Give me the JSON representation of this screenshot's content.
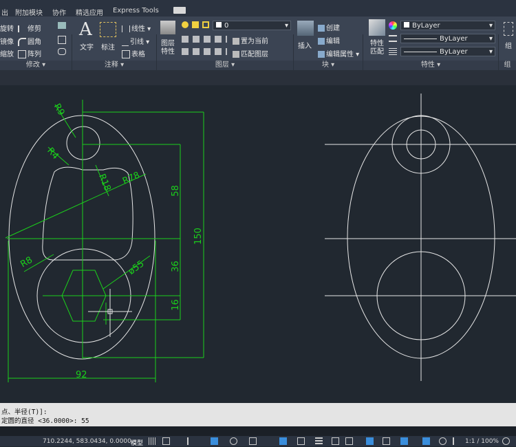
{
  "menu": {
    "items": [
      "出",
      "附加模块",
      "协作",
      "精选应用",
      "Express Tools"
    ]
  },
  "ribbon": {
    "modify": {
      "items": [
        "旋转",
        "修剪",
        "镜像",
        "圆角",
        "缩放",
        "阵列"
      ],
      "title": "修改"
    },
    "annotate": {
      "text_label": "文字",
      "dim_label": "标注",
      "linear": "线性",
      "leader": "引线",
      "table": "表格",
      "title": "注释"
    },
    "layers": {
      "props_label": "图层\n特性",
      "layer_value": "0",
      "set_current": "置为当前",
      "match_layer": "匹配图层",
      "title": "图层"
    },
    "block": {
      "insert_label": "插入",
      "create": "创建",
      "edit": "编辑",
      "edit_attr": "编辑属性",
      "title": "块"
    },
    "properties": {
      "match_label": "特性\n匹配",
      "color": "ByLayer",
      "linetype": "ByLayer",
      "lineweight": "ByLayer",
      "title": "特性"
    },
    "group": {
      "label": "组"
    }
  },
  "dims": {
    "r9": "R9",
    "r4": "R4",
    "r18": "R18",
    "r78": "R78",
    "r8": "R8",
    "d55": "ø55",
    "d58": "58",
    "d150": "150",
    "d36": "36",
    "d16": "16",
    "d92": "92"
  },
  "command": {
    "line1": "点、半径(T)]:",
    "line2": "定圆的直径 <36.0000>: 55"
  },
  "status": {
    "coords": "710.2244, 583.0434, 0.0000",
    "model": "模型",
    "scale": "1:1 / 100%"
  },
  "colors": {
    "dim_green": "#1bd11b",
    "geometry": "#e8e8e8",
    "background": "#212830"
  }
}
